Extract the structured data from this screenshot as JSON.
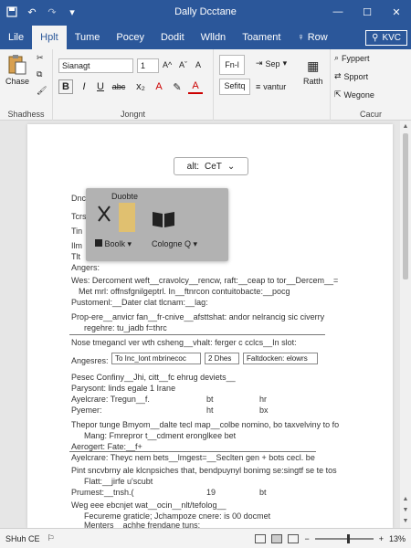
{
  "titlebar": {
    "title": "Dally Dcctane",
    "save_icon": "save-icon",
    "undo_icon": "undo-icon",
    "redo_icon": "redo-icon",
    "minimize": "—",
    "maximize": "☐",
    "close": "✕"
  },
  "tabs": {
    "items": [
      "Lile",
      "Hplt",
      "Tume",
      "Pocey",
      "Dodit",
      "Wlldn",
      "Toament"
    ],
    "active": 1,
    "tell": "♀ Row",
    "search": "KVC"
  },
  "ribbon": {
    "clipboard": {
      "paste": "Chase",
      "label": "Shadhess"
    },
    "font": {
      "font_name": "Sianagt",
      "font_size": "1",
      "bold": "B",
      "italic": "I",
      "underline": "U",
      "strike": "abc",
      "case": "A",
      "label": "Jongnt"
    },
    "paragraph": {
      "styles1": "Fn-l",
      "styles2": "Sefitq",
      "sep": "Sep",
      "vtext": "vantur",
      "ratth": "Ratth",
      "label": "Jongnt"
    },
    "editing": {
      "find": "Fyppert",
      "replace": "Spport",
      "select": "Wegone",
      "label": "Cacur"
    }
  },
  "document": {
    "find_box": {
      "left": "alt:",
      "right": "CeT"
    },
    "popup": {
      "label1": "Boolk",
      "label2": "Cologne Q",
      "header": "Duobte"
    },
    "lines": [
      "Dnc",
      "Tcrs",
      "Tin",
      "Ilm",
      "Tlt",
      "Angers:",
      "Wes: Dercoment weft__cravolcy__rencw, raft:__ceap to tor__Dercem__=",
      "Met mrl: offnsfgnilgeptrl. In__ftnrcon contuitobacte:__pocg",
      "Pustomenl:__Dater clat tlcnam:__lag:",
      "Prop-ere__anvicr fan__fr-cnive__afsttshat: andor nelrancig sic civerry",
      "regehre: tu_jadb f=thrc",
      "Nose  tmegancl ver wth csheng__vhalt: ferger c cclcs__In slot:",
      "Angesres:",
      "Pesec  Confiny__Jhi, citt__fc ehrug deviets__",
      "Parysont:  linds egale  1 Irane",
      "Ayelcrare:  Tregun__f.",
      "Pyemer:",
      "Thepor tunge Bmyom__dalte tecl map__colbe nomino, bo taxvelviny to fo",
      "Mang:  Fmrepror t__cdment eronglkee bet",
      "Aerogert:  Fate:__f+",
      "Ayelcrare:  Theyc nem bets__lmgest=__Seclten gen + bots cecl. be",
      "Pint sncvbrny ale klcnpsiches that, bendpuynyl bonimg se:singtf se te tos",
      "Flatt:__jirfe u'scubt",
      "Prumest:__tnsh.(",
      "Weg eee ebcnjet wat__ocin__nlt/tefolog__",
      "Fecureme graticle; Jchampoze cnere:  is 00 docmet",
      "Menters__achhe frendane tuns:"
    ],
    "cells": {
      "c1": "To Inc_lont mbrinecoc",
      "c2": "2 Dhes",
      "c3": "Faltdocken: elowrs"
    },
    "numbers": [
      "bt",
      "hr",
      "ht",
      "bx",
      "19",
      "bt"
    ]
  },
  "statusbar": {
    "left": "SHuh CE",
    "zoom": "13%",
    "zoom_level": 0.55
  }
}
